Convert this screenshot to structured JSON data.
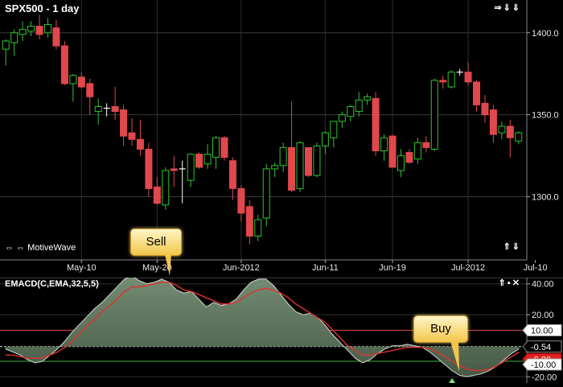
{
  "price_panel": {
    "title": "SPX500 - 1 day",
    "logo_text": "MotiveWave",
    "logo_icon": "arrows-icon",
    "controls": [
      "arrow-right",
      "arrow-down",
      "arrow-down"
    ],
    "y_labels": [
      "1400.0",
      "1350.0",
      "1300.0"
    ],
    "x_labels": [
      "May-10",
      "May-20",
      "Jun-2012",
      "Jun-11",
      "Jun-19",
      "Jul-2012",
      "Jul-10"
    ]
  },
  "indicator_panel": {
    "title": "EMACD(C,EMA,32,5,5)",
    "controls": [
      "arrow-up",
      "restore",
      "close"
    ],
    "y_labels": [
      "40.00",
      "20.00",
      "-20.00"
    ],
    "badges": {
      "upper": "10.00",
      "zero": "-0.54",
      "lower": "-10.00",
      "signal": "-6.00"
    },
    "colors": {
      "fill": "#5e765c",
      "signal": "#e03030",
      "upper_line": "#d24a4a",
      "lower_line": "#40b040",
      "badge_red": "#e02020"
    }
  },
  "callouts": {
    "sell": "Sell",
    "buy": "Buy"
  },
  "chart_data": {
    "type": "candlestick",
    "title": "SPX500 - 1 day",
    "ylim": [
      1262,
      1420
    ],
    "candles": [
      {
        "o": 1390,
        "h": 1396,
        "l": 1380,
        "c": 1395
      },
      {
        "o": 1394,
        "h": 1402,
        "l": 1386,
        "c": 1400
      },
      {
        "o": 1399,
        "h": 1407,
        "l": 1395,
        "c": 1402
      },
      {
        "o": 1401,
        "h": 1407,
        "l": 1398,
        "c": 1404
      },
      {
        "o": 1404,
        "h": 1411,
        "l": 1396,
        "c": 1399
      },
      {
        "o": 1400,
        "h": 1409,
        "l": 1397,
        "c": 1405
      },
      {
        "o": 1403,
        "h": 1408,
        "l": 1390,
        "c": 1392
      },
      {
        "o": 1392,
        "h": 1395,
        "l": 1368,
        "c": 1369
      },
      {
        "o": 1369,
        "h": 1375,
        "l": 1358,
        "c": 1374
      },
      {
        "o": 1373,
        "h": 1376,
        "l": 1366,
        "c": 1367
      },
      {
        "o": 1369,
        "h": 1372,
        "l": 1350,
        "c": 1361
      },
      {
        "o": 1352,
        "h": 1360,
        "l": 1344,
        "c": 1355
      },
      {
        "o": 1354,
        "h": 1357,
        "l": 1349,
        "c": 1354
      },
      {
        "o": 1355,
        "h": 1367,
        "l": 1347,
        "c": 1352
      },
      {
        "o": 1353,
        "h": 1356,
        "l": 1331,
        "c": 1337
      },
      {
        "o": 1339,
        "h": 1348,
        "l": 1331,
        "c": 1335
      },
      {
        "o": 1335,
        "h": 1347,
        "l": 1325,
        "c": 1329
      },
      {
        "o": 1329,
        "h": 1333,
        "l": 1300,
        "c": 1305
      },
      {
        "o": 1306,
        "h": 1312,
        "l": 1295,
        "c": 1296
      },
      {
        "o": 1295,
        "h": 1318,
        "l": 1292,
        "c": 1316
      },
      {
        "o": 1317,
        "h": 1325,
        "l": 1306,
        "c": 1316
      },
      {
        "o": 1317,
        "h": 1322,
        "l": 1296,
        "c": 1317
      },
      {
        "o": 1310,
        "h": 1326,
        "l": 1306,
        "c": 1326
      },
      {
        "o": 1326,
        "h": 1327,
        "l": 1317,
        "c": 1318
      },
      {
        "o": 1320,
        "h": 1332,
        "l": 1317,
        "c": 1326
      },
      {
        "o": 1324,
        "h": 1337,
        "l": 1317,
        "c": 1336
      },
      {
        "o": 1336,
        "h": 1337,
        "l": 1322,
        "c": 1324
      },
      {
        "o": 1322,
        "h": 1324,
        "l": 1298,
        "c": 1305
      },
      {
        "o": 1305,
        "h": 1307,
        "l": 1285,
        "c": 1290
      },
      {
        "o": 1294,
        "h": 1298,
        "l": 1271,
        "c": 1276
      },
      {
        "o": 1276,
        "h": 1289,
        "l": 1273,
        "c": 1286
      },
      {
        "o": 1287,
        "h": 1320,
        "l": 1282,
        "c": 1317
      },
      {
        "o": 1317,
        "h": 1321,
        "l": 1312,
        "c": 1319
      },
      {
        "o": 1319,
        "h": 1333,
        "l": 1315,
        "c": 1330
      },
      {
        "o": 1330,
        "h": 1358,
        "l": 1303,
        "c": 1304
      },
      {
        "o": 1305,
        "h": 1334,
        "l": 1303,
        "c": 1333
      },
      {
        "o": 1330,
        "h": 1330,
        "l": 1312,
        "c": 1313
      },
      {
        "o": 1313,
        "h": 1333,
        "l": 1312,
        "c": 1331
      },
      {
        "o": 1331,
        "h": 1340,
        "l": 1326,
        "c": 1339
      },
      {
        "o": 1336,
        "h": 1346,
        "l": 1330,
        "c": 1346
      },
      {
        "o": 1346,
        "h": 1352,
        "l": 1342,
        "c": 1350
      },
      {
        "o": 1349,
        "h": 1356,
        "l": 1346,
        "c": 1355
      },
      {
        "o": 1352,
        "h": 1364,
        "l": 1349,
        "c": 1359
      },
      {
        "o": 1359,
        "h": 1363,
        "l": 1356,
        "c": 1361
      },
      {
        "o": 1360,
        "h": 1364,
        "l": 1325,
        "c": 1328
      },
      {
        "o": 1328,
        "h": 1338,
        "l": 1322,
        "c": 1336
      },
      {
        "o": 1337,
        "h": 1338,
        "l": 1318,
        "c": 1318
      },
      {
        "o": 1316,
        "h": 1329,
        "l": 1312,
        "c": 1325
      },
      {
        "o": 1327,
        "h": 1329,
        "l": 1320,
        "c": 1321
      },
      {
        "o": 1323,
        "h": 1336,
        "l": 1320,
        "c": 1333
      },
      {
        "o": 1333,
        "h": 1337,
        "l": 1327,
        "c": 1330
      },
      {
        "o": 1329,
        "h": 1372,
        "l": 1328,
        "c": 1371
      },
      {
        "o": 1371,
        "h": 1374,
        "l": 1366,
        "c": 1370
      },
      {
        "o": 1367,
        "h": 1377,
        "l": 1366,
        "c": 1376
      },
      {
        "o": 1376,
        "h": 1378,
        "l": 1374,
        "c": 1376
      },
      {
        "o": 1376,
        "h": 1382,
        "l": 1368,
        "c": 1370
      },
      {
        "o": 1370,
        "h": 1371,
        "l": 1352,
        "c": 1356
      },
      {
        "o": 1357,
        "h": 1362,
        "l": 1345,
        "c": 1350
      },
      {
        "o": 1353,
        "h": 1356,
        "l": 1333,
        "c": 1338
      },
      {
        "o": 1339,
        "h": 1346,
        "l": 1335,
        "c": 1343
      },
      {
        "o": 1343,
        "h": 1347,
        "l": 1324,
        "c": 1336
      },
      {
        "o": 1334,
        "h": 1340,
        "l": 1332,
        "c": 1339
      }
    ],
    "indicator": {
      "name": "EMACD(C,EMA,32,5,5)",
      "ylim": [
        -24,
        44
      ],
      "levels": [
        10,
        -0.54,
        -10
      ],
      "histogram": [
        -2,
        -4,
        -6,
        -9,
        -11,
        -10,
        -6,
        -2,
        3,
        9,
        14,
        19,
        24,
        28,
        33,
        38,
        43,
        45,
        42,
        40,
        41,
        43,
        41,
        36,
        34,
        35,
        30,
        25,
        28,
        26,
        27,
        30,
        36,
        41,
        43,
        43,
        39,
        33,
        27,
        22,
        20,
        21,
        18,
        13,
        7,
        2,
        -3,
        -8,
        -11,
        -9,
        -5,
        -2,
        0,
        0,
        1,
        0,
        -1,
        -4,
        -8,
        -12,
        -16,
        -19,
        -20,
        -19,
        -18,
        -16,
        -13,
        -9,
        -5,
        -2
      ],
      "signal": [
        -6,
        -6,
        -7,
        -8,
        -8,
        -8,
        -6,
        -4,
        -1,
        3,
        8,
        13,
        17,
        22,
        26,
        30,
        35,
        38,
        38,
        39,
        40,
        41,
        41,
        39,
        36,
        35,
        33,
        31,
        29,
        27,
        27,
        28,
        31,
        34,
        36,
        37,
        36,
        34,
        31,
        27,
        24,
        21,
        18,
        15,
        10,
        5,
        0,
        -3,
        -6,
        -6,
        -5,
        -4,
        -3,
        -2,
        -1,
        -1,
        -1,
        -2,
        -4,
        -7,
        -10,
        -13,
        -15,
        -16,
        -16,
        -15,
        -13,
        -10,
        -7,
        -4
      ]
    }
  }
}
